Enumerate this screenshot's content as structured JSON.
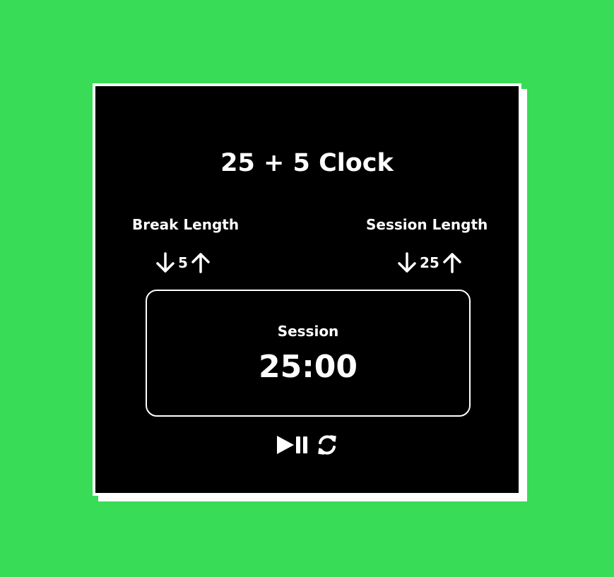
{
  "app": {
    "title": "25 + 5 Clock"
  },
  "break": {
    "label": "Break Length",
    "value": "5",
    "decrement_icon": "arrow-down-icon",
    "increment_icon": "arrow-up-icon"
  },
  "session": {
    "label": "Session Length",
    "value": "25",
    "decrement_icon": "arrow-down-icon",
    "increment_icon": "arrow-up-icon"
  },
  "timer": {
    "label": "Session",
    "time_left": "25:00"
  },
  "controls": {
    "start_stop_icon": "play-pause-icon",
    "reset_icon": "refresh-icon"
  },
  "colors": {
    "background": "#38dc56",
    "card": "#000000",
    "border": "#ffffff",
    "text": "#ffffff"
  }
}
